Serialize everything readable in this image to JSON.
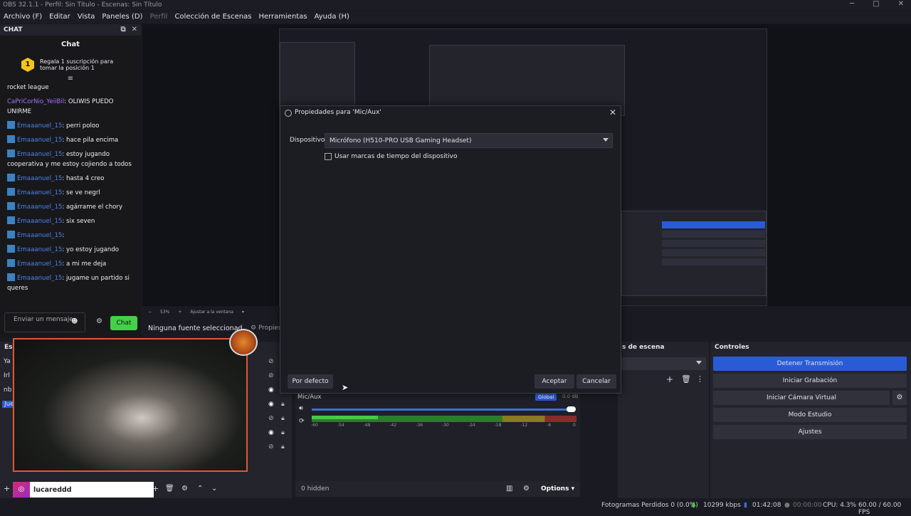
{
  "window": {
    "title": "OBS 32.1.1 - Perfil: Sin Título - Escenas: Sin Título"
  },
  "menu": [
    {
      "label": "Archivo (F)",
      "dim": false
    },
    {
      "label": "Editar",
      "dim": false
    },
    {
      "label": "Vista",
      "dim": false
    },
    {
      "label": "Paneles (D)",
      "dim": false
    },
    {
      "label": "Perfil",
      "dim": true
    },
    {
      "label": "Colección de Escenas",
      "dim": false
    },
    {
      "label": "Herramientas",
      "dim": false
    },
    {
      "label": "Ayuda (H)",
      "dim": false
    }
  ],
  "chat": {
    "dock_title": "CHAT",
    "title": "Chat",
    "promo": "Regala 1 suscripción para tomar la posición 1",
    "promo_rank": "1",
    "first_line": "rocket league",
    "messages": [
      {
        "user": "CaPriCorNio_YeiiBil",
        "text": ": OLIWIS PUEDO UNIRME",
        "color": "purple",
        "icon": false
      },
      {
        "user": "Emaaanuel_15",
        "text": ": perri poloo",
        "color": "blue",
        "icon": true
      },
      {
        "user": "Emaaanuel_15",
        "text": ": hace pila encima",
        "color": "blue",
        "icon": true
      },
      {
        "user": "Emaaanuel_15",
        "text": ": estoy jugando cooperativa y me estoy cojiendo a todos",
        "color": "blue",
        "icon": true
      },
      {
        "user": "Emaaanuel_15",
        "text": ": hasta 4 creo",
        "color": "blue",
        "icon": true
      },
      {
        "user": "Emaaanuel_15",
        "text": ": se ve negrl",
        "color": "blue",
        "icon": true
      },
      {
        "user": "Emaaanuel_15",
        "text": ": agárrame el chory",
        "color": "blue",
        "icon": true
      },
      {
        "user": "Emaaanuel_15",
        "text": ": six seven",
        "color": "blue",
        "icon": true
      },
      {
        "user": "Emaaanuel_15",
        "text": ":",
        "color": "blue",
        "icon": true
      },
      {
        "user": "Emaaanuel_15",
        "text": ": yo estoy jugando",
        "color": "blue",
        "icon": true
      },
      {
        "user": "Emaaanuel_15",
        "text": ": a mi me deja",
        "color": "blue",
        "icon": true
      },
      {
        "user": "Emaaanuel_15",
        "text": ": jugame un partido si queres",
        "color": "blue",
        "icon": true
      }
    ],
    "input_placeholder": "Enviar un mensaje",
    "send_label": "Chat"
  },
  "preview": {
    "zoom": "53%",
    "zoom_mode": "Ajustar a la ventana",
    "no_source": "Ninguna fuente seleccionad",
    "properties": "Propied"
  },
  "scenes": {
    "title": "Esc",
    "items": [
      "Ya",
      "Irl",
      "nb",
      "Jue"
    ]
  },
  "transitions": {
    "title": "s de escena"
  },
  "controls": {
    "title": "Controles",
    "buttons": [
      "Detener Transmisión",
      "Iniciar Grabación",
      "Iniciar Cámara Virtual",
      "Modo Estudio",
      "Ajustes"
    ]
  },
  "mixer": {
    "source": "Mic/Aux",
    "badge": "Global",
    "db": "0.0 dB",
    "ticks": [
      "-60",
      "-54",
      "-48",
      "-42",
      "-36",
      "-30",
      "-24",
      "-18",
      "-12",
      "-6",
      "0"
    ],
    "level": 0.25,
    "hidden": "0 hidden",
    "options": "Options"
  },
  "dialog": {
    "title": "Propiedades para 'Mic/Aux'",
    "device_label": "Dispositivo",
    "device_value": "Micrófono (H510-PRO USB Gaming Headset)",
    "timestamp_label": "Usar marcas de tiempo del dispositivo",
    "default_btn": "Por defecto",
    "ok_btn": "Aceptar",
    "cancel_btn": "Cancelar"
  },
  "overlay": {
    "instagram": "lucareddd"
  },
  "status": {
    "dropped": "Fotogramas Perdidos 0 (0.0%)",
    "bitrate": "10299 kbps",
    "stream_time": "01:42:08",
    "rec_time": "00:00:00",
    "cpu": "CPU: 4.3%",
    "fps": "60.00 / 60.00 FPS"
  },
  "colors": {
    "accent": "#2a5bd7",
    "chat_send": "#43d14a",
    "webcam_border": "#e4572e"
  }
}
